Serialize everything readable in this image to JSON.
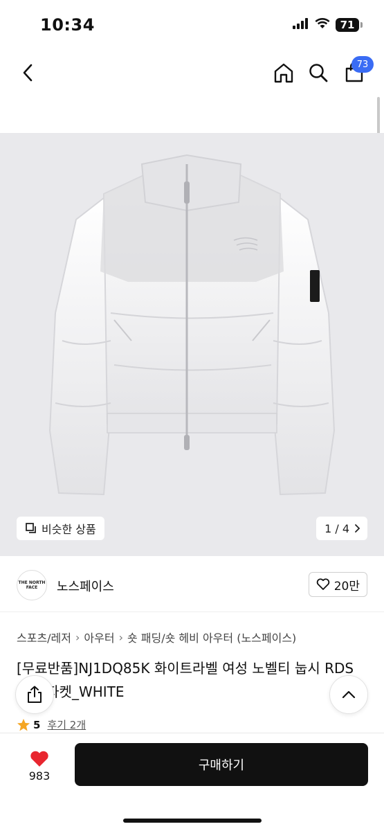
{
  "status_bar": {
    "time": "10:34",
    "battery": "71",
    "icons": [
      "signal-icon",
      "wifi-icon",
      "battery-icon"
    ]
  },
  "nav": {
    "icons": [
      "back-arrow-icon",
      "home-icon",
      "search-icon",
      "cart-icon"
    ],
    "cart_count": "73"
  },
  "product_image": {
    "similar_label": "비슷한 상품",
    "page_indicator": "1 / 4",
    "background": "#e9e9ec"
  },
  "brand": {
    "logo_text": "THE NORTH FACE",
    "name": "노스페이스",
    "like_count": "20만"
  },
  "breadcrumb": [
    "스포츠/레저",
    "아우터",
    "숏 패딩/숏 헤비 아우터 (노스페이스)"
  ],
  "product": {
    "title": "[무료반품]NJ1DQ85K 화이트라벨 여성 노벨티 눕시 RDS 다운 자켓_WHITE",
    "rating": "5",
    "reviews": "후기 2개"
  },
  "bottom_bar": {
    "wish_count": "983",
    "buy_label": "구매하기",
    "heart_color": "#e8262f",
    "buy_color": "#111111"
  },
  "colors": {
    "badge": "#3a6cf4",
    "star": "#f5a623"
  }
}
